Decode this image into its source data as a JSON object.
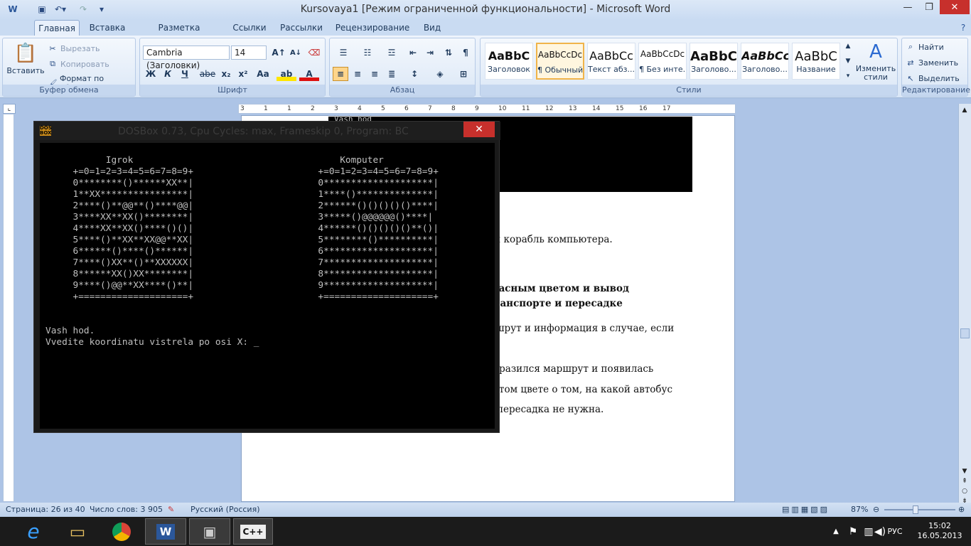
{
  "window": {
    "title": "Kursovaya1 [Режим ограниченной функциональности] - Microsoft Word",
    "qat_menu": "▾"
  },
  "tabs": [
    {
      "label": "Главная"
    },
    {
      "label": "Вставка"
    },
    {
      "label": "Разметка страницы"
    },
    {
      "label": "Ссылки"
    },
    {
      "label": "Рассылки"
    },
    {
      "label": "Рецензирование"
    },
    {
      "label": "Вид"
    }
  ],
  "clipboard": {
    "paste": "Вставить",
    "cut": "Вырезать",
    "copy": "Копировать",
    "format": "Формат по образцу",
    "group": "Буфер обмена"
  },
  "font": {
    "name": "Cambria (Заголовки)",
    "size": "14",
    "group": "Шрифт",
    "bold": "Ж",
    "italic": "К",
    "underline": "Ч",
    "strike": "abe",
    "sub": "x₂",
    "sup": "x²",
    "case": "Aa"
  },
  "paragraph": {
    "group": "Абзац",
    "pilcrow": "¶"
  },
  "styles": {
    "group": "Стили",
    "items": [
      {
        "sample": "AaBbC",
        "name": "Заголовок"
      },
      {
        "sample": "AaBbCcDc",
        "name": "¶ Обычный"
      },
      {
        "sample": "AaBbCc",
        "name": "Текст абз..."
      },
      {
        "sample": "AaBbCcDc",
        "name": "¶ Без инте..."
      },
      {
        "sample": "AaBbC",
        "name": "Заголово..."
      },
      {
        "sample": "AaBbCc",
        "name": "Заголово..."
      },
      {
        "sample": "AaBbC",
        "name": "Название"
      }
    ],
    "change": "Изменить стили"
  },
  "editing": {
    "group": "Редактирование",
    "find": "Найти",
    "replace": "Заменить",
    "select": "Выделить"
  },
  "ruler": {
    "marks": [
      "3",
      "1",
      "1",
      "2",
      "3",
      "4",
      "5",
      "6",
      "7",
      "8",
      "9",
      "10",
      "11",
      "12",
      "13",
      "14",
      "15",
      "16",
      "17"
    ]
  },
  "document": {
    "lines": [
      "тый корабль компьютера.",
      "расным цветом и вывод",
      "ранспорте и пересадке",
      "шрут и информация в случае, если",
      "бразился маршрут и появилась",
      "том цвете о том, на какой автобус",
      "пересадка не нужна."
    ],
    "image_text": "Vash hod"
  },
  "dosbox": {
    "title": "DOSBox 0.73, Cpu Cycles:      max, Frameskip  0, Program:      BC",
    "close": "✕",
    "left": [
      "           Igrok",
      "     +=0=1=2=3=4=5=6=7=8=9+",
      "     0********()******XX**|",
      "     1**XX****************|",
      "     2****()**@@**()****@@|",
      "     3****XX**XX()********|",
      "     4****XX**XX()****()()|",
      "     5****()**XX**XX@@**XX|",
      "     6******()****()******|",
      "     7****()XX**()**XXXXXX|",
      "     8******XX()XX********|",
      "     9****()@@**XX****()**|",
      "     +====================+"
    ],
    "right": [
      "      Komputer",
      "  +=0=1=2=3=4=5=6=7=8=9+",
      "  0********************|",
      "  1****()**************|",
      "  2******()()()()()****|",
      "  3*****()@@@@@@()****|",
      "  4******()()()()()**()|",
      "  5********()**********|",
      "  6********************|",
      "  7********************|",
      "  8********************|",
      "  9********************|",
      "  +====================+"
    ],
    "prompt1": "Vash hod.",
    "prompt2": "Vvedite koordinatu vistrela po osi X: _"
  },
  "status": {
    "page": "Страница: 26 из 40",
    "words": "Число слов: 3 905",
    "lang": "Русский (Россия)",
    "zoom": "87%"
  },
  "tray": {
    "lang": "РУС",
    "time": "15:02",
    "date": "16.05.2013"
  }
}
